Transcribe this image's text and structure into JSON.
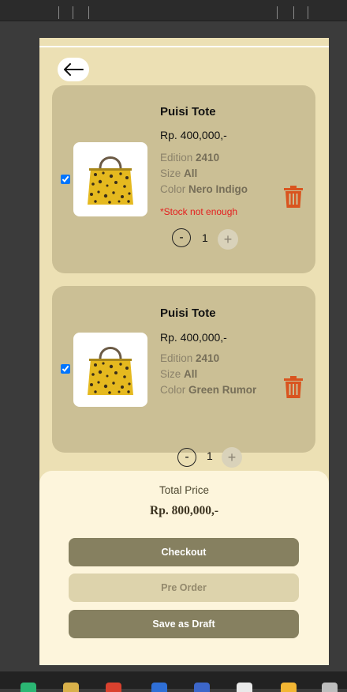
{
  "back": {
    "icon": "arrow-left-icon"
  },
  "cart": [
    {
      "checked": true,
      "name": "Puisi Tote",
      "price": "Rp. 400,000,-",
      "edition_label": "Edition",
      "edition": "2410",
      "size_label": "Size",
      "size": "All",
      "color_label": "Color",
      "color": "Nero Indigo",
      "warning": "*Stock not enough",
      "quantity": "1",
      "minus": "-",
      "plus": "+"
    },
    {
      "checked": true,
      "name": "Puisi Tote",
      "price": "Rp. 400,000,-",
      "edition_label": "Edition",
      "edition": "2410",
      "size_label": "Size",
      "size": "All",
      "color_label": "Color",
      "color": "Green Rumor",
      "quantity": "1",
      "minus": "-",
      "plus": "+"
    }
  ],
  "summary": {
    "total_label": "Total Price",
    "total_value": "Rp.  800,000,-",
    "checkout": "Checkout",
    "preorder": "Pre Order",
    "draft": "Save as Draft"
  },
  "colors": {
    "background": "#ece0b4",
    "card": "#cbbf95",
    "button_dark": "#868060",
    "button_light": "#ddd3ac",
    "warning": "#e41e1e",
    "trash": "#d9541f"
  }
}
